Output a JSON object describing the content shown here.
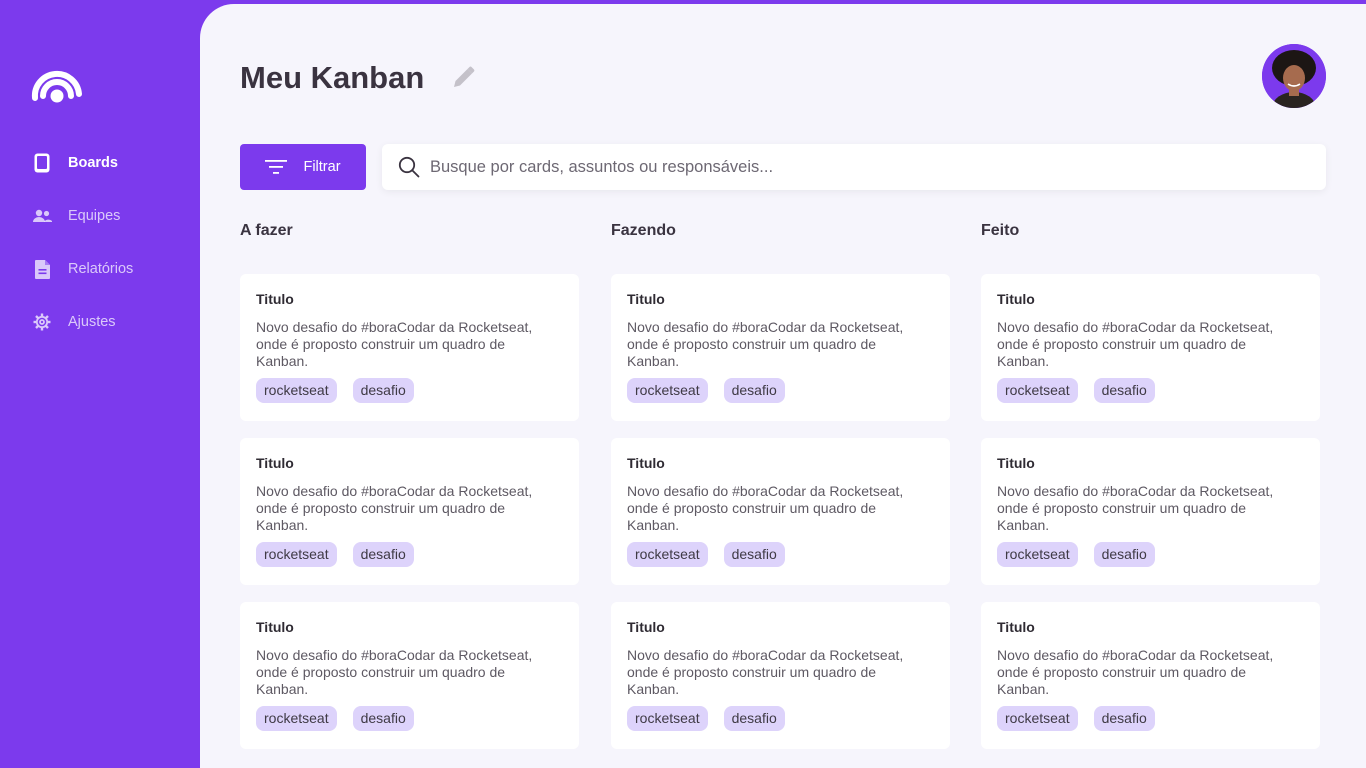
{
  "sidebar": {
    "items": [
      {
        "label": "Boards",
        "icon": "tablet-icon",
        "active": true
      },
      {
        "label": "Equipes",
        "icon": "users-icon",
        "active": false
      },
      {
        "label": "Relatórios",
        "icon": "document-icon",
        "active": false
      },
      {
        "label": "Ajustes",
        "icon": "gear-icon",
        "active": false
      }
    ]
  },
  "header": {
    "title": "Meu Kanban"
  },
  "toolbar": {
    "filter_label": "Filtrar",
    "search_placeholder": "Busque por cards, assuntos ou responsáveis..."
  },
  "columns": [
    {
      "title": "A fazer",
      "cards": [
        {
          "title": "Titulo",
          "description": "Novo desafio do #boraCodar da Rocketseat, onde é proposto construir um quadro de Kanban.",
          "tags": [
            "rocketseat",
            "desafio"
          ]
        },
        {
          "title": "Titulo",
          "description": "Novo desafio do #boraCodar da Rocketseat, onde é proposto construir um quadro de Kanban.",
          "tags": [
            "rocketseat",
            "desafio"
          ]
        },
        {
          "title": "Titulo",
          "description": "Novo desafio do #boraCodar da Rocketseat, onde é proposto construir um quadro de Kanban.",
          "tags": [
            "rocketseat",
            "desafio"
          ]
        }
      ]
    },
    {
      "title": "Fazendo",
      "cards": [
        {
          "title": "Titulo",
          "description": "Novo desafio do #boraCodar da Rocketseat, onde é proposto construir um quadro de Kanban.",
          "tags": [
            "rocketseat",
            "desafio"
          ]
        },
        {
          "title": "Titulo",
          "description": "Novo desafio do #boraCodar da Rocketseat, onde é proposto construir um quadro de Kanban.",
          "tags": [
            "rocketseat",
            "desafio"
          ]
        },
        {
          "title": "Titulo",
          "description": "Novo desafio do #boraCodar da Rocketseat, onde é proposto construir um quadro de Kanban.",
          "tags": [
            "rocketseat",
            "desafio"
          ]
        }
      ]
    },
    {
      "title": "Feito",
      "cards": [
        {
          "title": "Titulo",
          "description": "Novo desafio do #boraCodar da Rocketseat, onde é proposto construir um quadro de Kanban.",
          "tags": [
            "rocketseat",
            "desafio"
          ]
        },
        {
          "title": "Titulo",
          "description": "Novo desafio do #boraCodar da Rocketseat, onde é proposto construir um quadro de Kanban.",
          "tags": [
            "rocketseat",
            "desafio"
          ]
        },
        {
          "title": "Titulo",
          "description": "Novo desafio do #boraCodar da Rocketseat, onde é proposto construir um quadro de Kanban.",
          "tags": [
            "rocketseat",
            "desafio"
          ]
        }
      ]
    }
  ],
  "colors": {
    "accent": "#7c3aed",
    "background": "#f6f5fc",
    "tag_bg": "#ddd3fb"
  }
}
